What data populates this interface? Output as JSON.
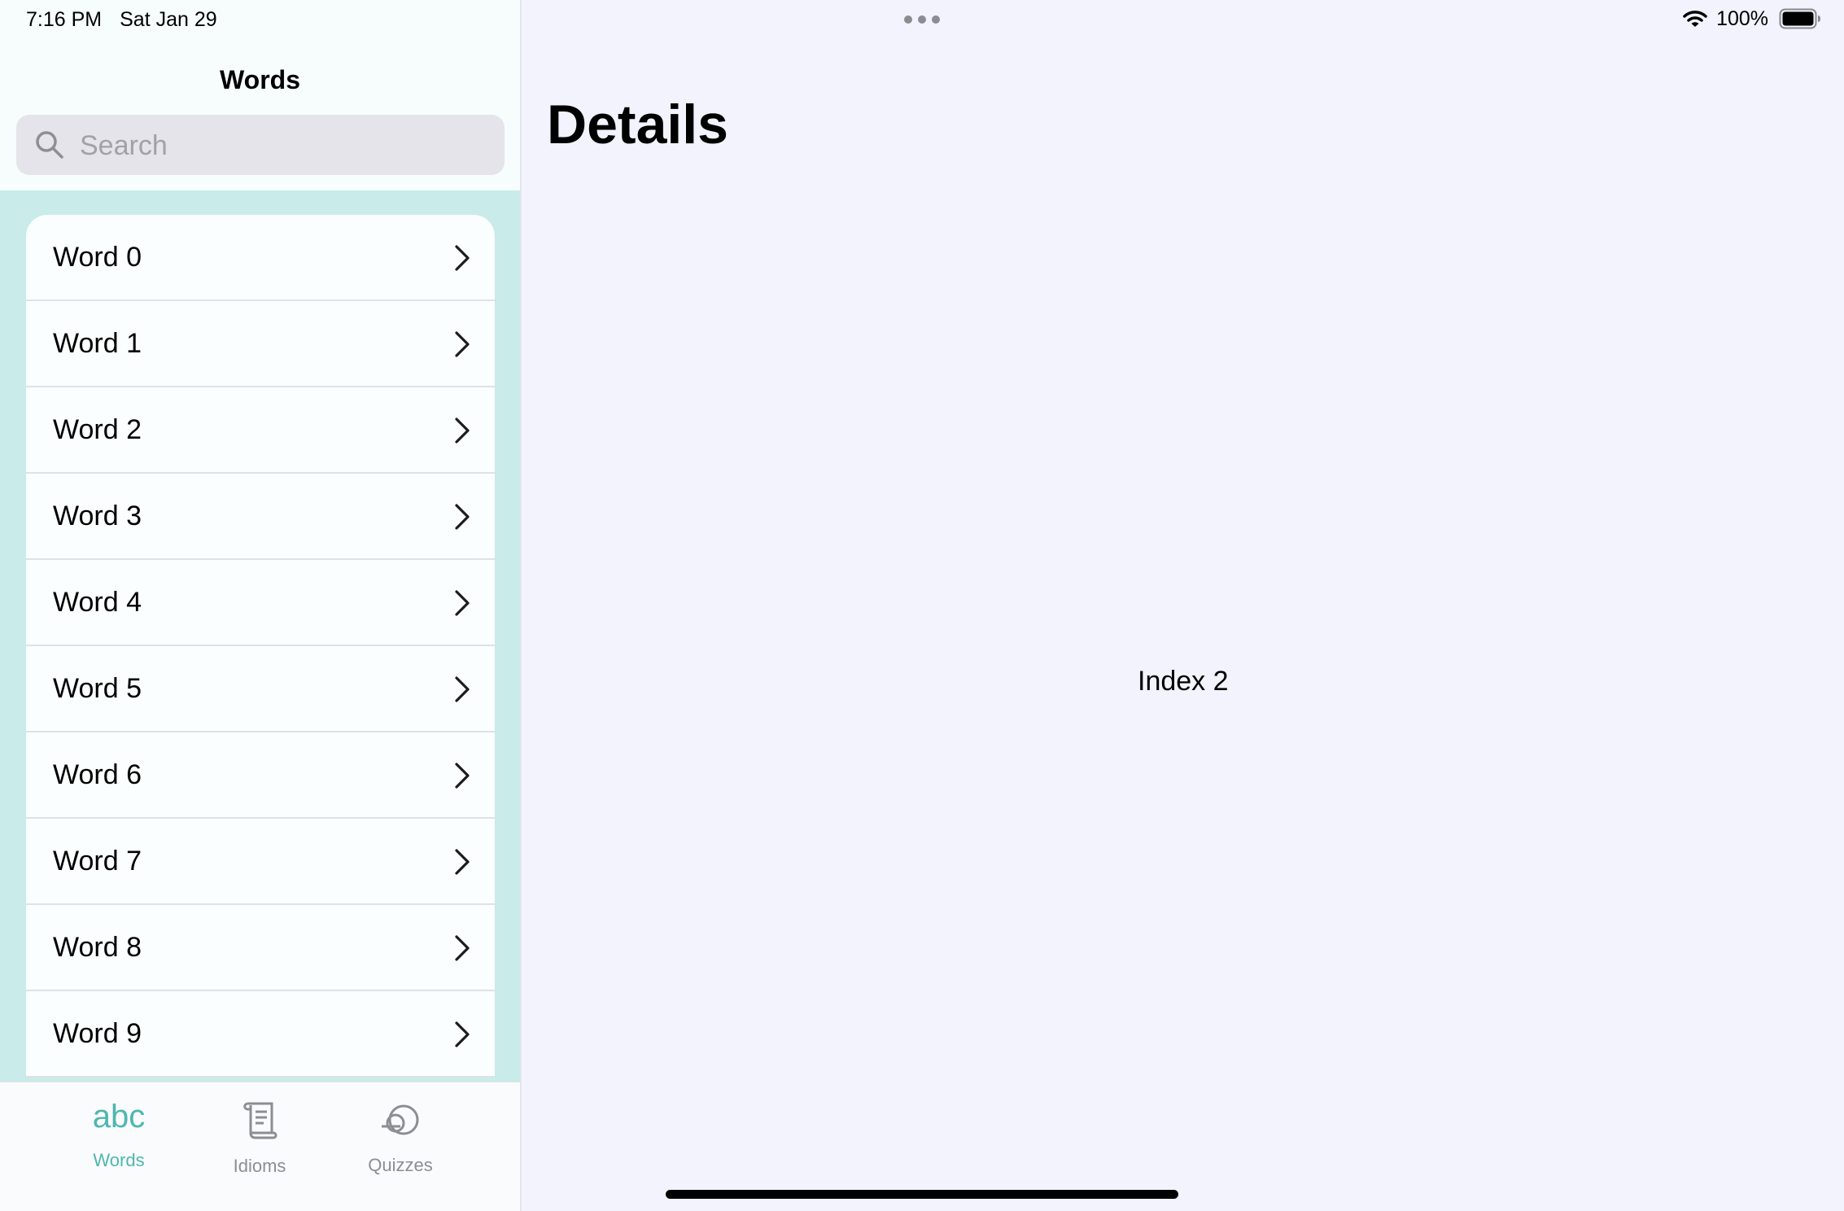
{
  "status_bar": {
    "time": "7:16 PM",
    "date": "Sat Jan 29",
    "battery": "100%",
    "icons": [
      "wifi-icon",
      "battery-icon",
      "multitasking-dots-icon"
    ]
  },
  "sidebar": {
    "title": "Words",
    "search": {
      "placeholder": "Search",
      "value": "",
      "icon": "search-icon"
    },
    "items": [
      {
        "label": "Word 0"
      },
      {
        "label": "Word 1"
      },
      {
        "label": "Word 2"
      },
      {
        "label": "Word 3"
      },
      {
        "label": "Word 4"
      },
      {
        "label": "Word 5"
      },
      {
        "label": "Word 6"
      },
      {
        "label": "Word 7"
      },
      {
        "label": "Word 8"
      },
      {
        "label": "Word 9"
      }
    ],
    "row_icon": "chevron-right-icon"
  },
  "tab_bar": {
    "tabs": [
      {
        "label": "Words",
        "icon_text": "abc",
        "icon": "abc-icon",
        "active": true
      },
      {
        "label": "Idioms",
        "icon": "scroll-icon",
        "active": false
      },
      {
        "label": "Quizzes",
        "icon": "quiz-icon",
        "active": false
      }
    ]
  },
  "detail": {
    "title": "Details",
    "content": "Index 2"
  },
  "colors": {
    "accent": "#4fb6b0",
    "list_background": "#c9ebe9",
    "detail_background": "#f2f3fd",
    "sidebar_background": "#f7fdfd"
  }
}
